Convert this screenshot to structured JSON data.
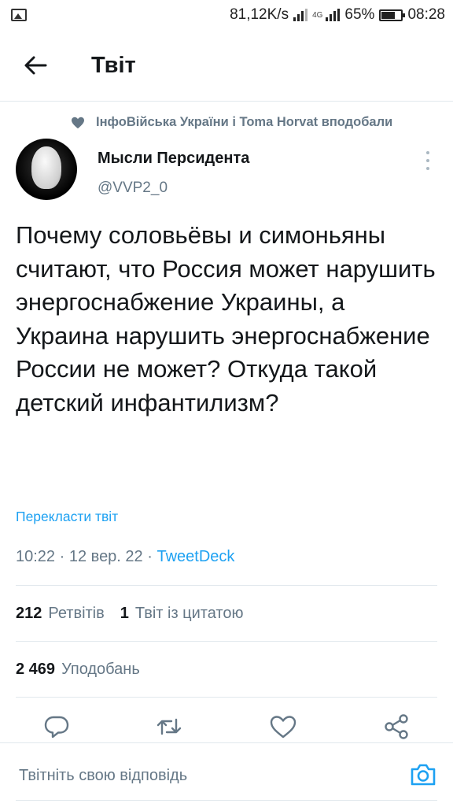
{
  "status_bar": {
    "speed": "81,12K/s",
    "network": "4G",
    "battery": "65%",
    "time": "08:28"
  },
  "header": {
    "title": "Твіт"
  },
  "social_context": {
    "text": "ІнфоВійська України і Toma Horvat вподобали"
  },
  "author": {
    "name": "Мысли Персидента",
    "handle": "@VVP2_0"
  },
  "tweet": {
    "text": "Почему соловьёвы и симоньяны считают, что Россия может нарушить энергоснабжение Украины, а Украина нарушить энергоснабжение России не может? Откуда такой детский инфантилизм?",
    "translate_label": "Перекласти твіт",
    "time": "10:22",
    "date": "12 вер. 22",
    "source": "TweetDeck",
    "separator": "·"
  },
  "stats": {
    "retweets_count": "212",
    "retweets_label": "Ретвітів",
    "quotes_count": "1",
    "quotes_label": "Твіт із цитатою",
    "likes_count": "2 469",
    "likes_label": "Уподобань"
  },
  "reply": {
    "placeholder": "Твітніть свою відповідь"
  },
  "icons": {
    "back": "arrow-left-icon",
    "heart": "heart-icon",
    "more": "more-vertical-icon",
    "reply": "reply-icon",
    "retweet": "retweet-icon",
    "like": "like-icon",
    "share": "share-icon",
    "camera": "camera-icon"
  },
  "colors": {
    "accent": "#1da1f2",
    "secondary_text": "#657786",
    "primary_text": "#14171a",
    "divider": "#e1e8ed"
  }
}
